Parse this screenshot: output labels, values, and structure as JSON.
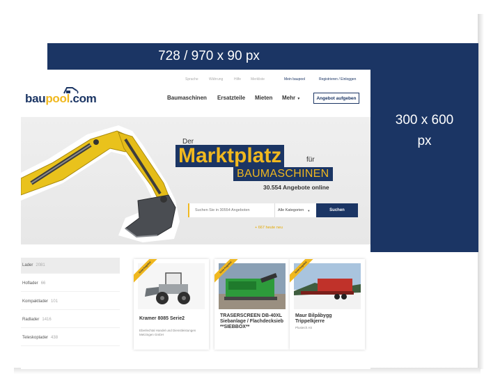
{
  "ads": {
    "top_label": "728 / 970 x 90 px",
    "side_line1": "300 x 600",
    "side_line2": "px"
  },
  "topbar": {
    "language": "Sprache",
    "currency": "Währung",
    "help": "Hilfe",
    "watchlist": "Merkliste",
    "my_account": "Mein baupool",
    "register": "Registrieren / Einloggen"
  },
  "logo": {
    "part1": "bau",
    "part2": "pool",
    "part3": ".com"
  },
  "nav": {
    "machines": "Baumaschinen",
    "parts": "Ersatzteile",
    "rent": "Mieten",
    "more": "Mehr",
    "offer_button": "Angebot aufgeben"
  },
  "hero": {
    "der": "Der",
    "marketplace": "Marktplatz",
    "fuer": "für",
    "machines": "BAUMASCHINEN",
    "count": "30.554 Angebote online",
    "search_placeholder": "Suchen Sie in 30554 Angeboten",
    "category": "Alle Kategorien",
    "search_button": "Suchen",
    "new_today": "+ 667 heute neu"
  },
  "categories": [
    {
      "label": "Lader",
      "count": "2081"
    },
    {
      "label": "Hoflader",
      "count": "66"
    },
    {
      "label": "Kompaktlader",
      "count": "101"
    },
    {
      "label": "Radlader",
      "count": "1416"
    },
    {
      "label": "Teleskoplader",
      "count": "438"
    }
  ],
  "cards": [
    {
      "ribbon": "Gold Angebot",
      "title": "Kramer 8085 Serie2",
      "sub": "Eberlechtal Handel und Dienstleistungen Metzingen GmbH"
    },
    {
      "ribbon": "Gold Angebot",
      "title": "TRASERSCREEN DB-40XL Siebanlage / Flachdecksieb **SIEBBOX**",
      "sub": ""
    },
    {
      "ribbon": "Gold Angebot",
      "title": "Maur Bilpåbygg Trippelkjerre",
      "sub": "Plustech AS"
    }
  ],
  "colors": {
    "navy": "#1b3564",
    "yellow": "#f0b81f"
  }
}
